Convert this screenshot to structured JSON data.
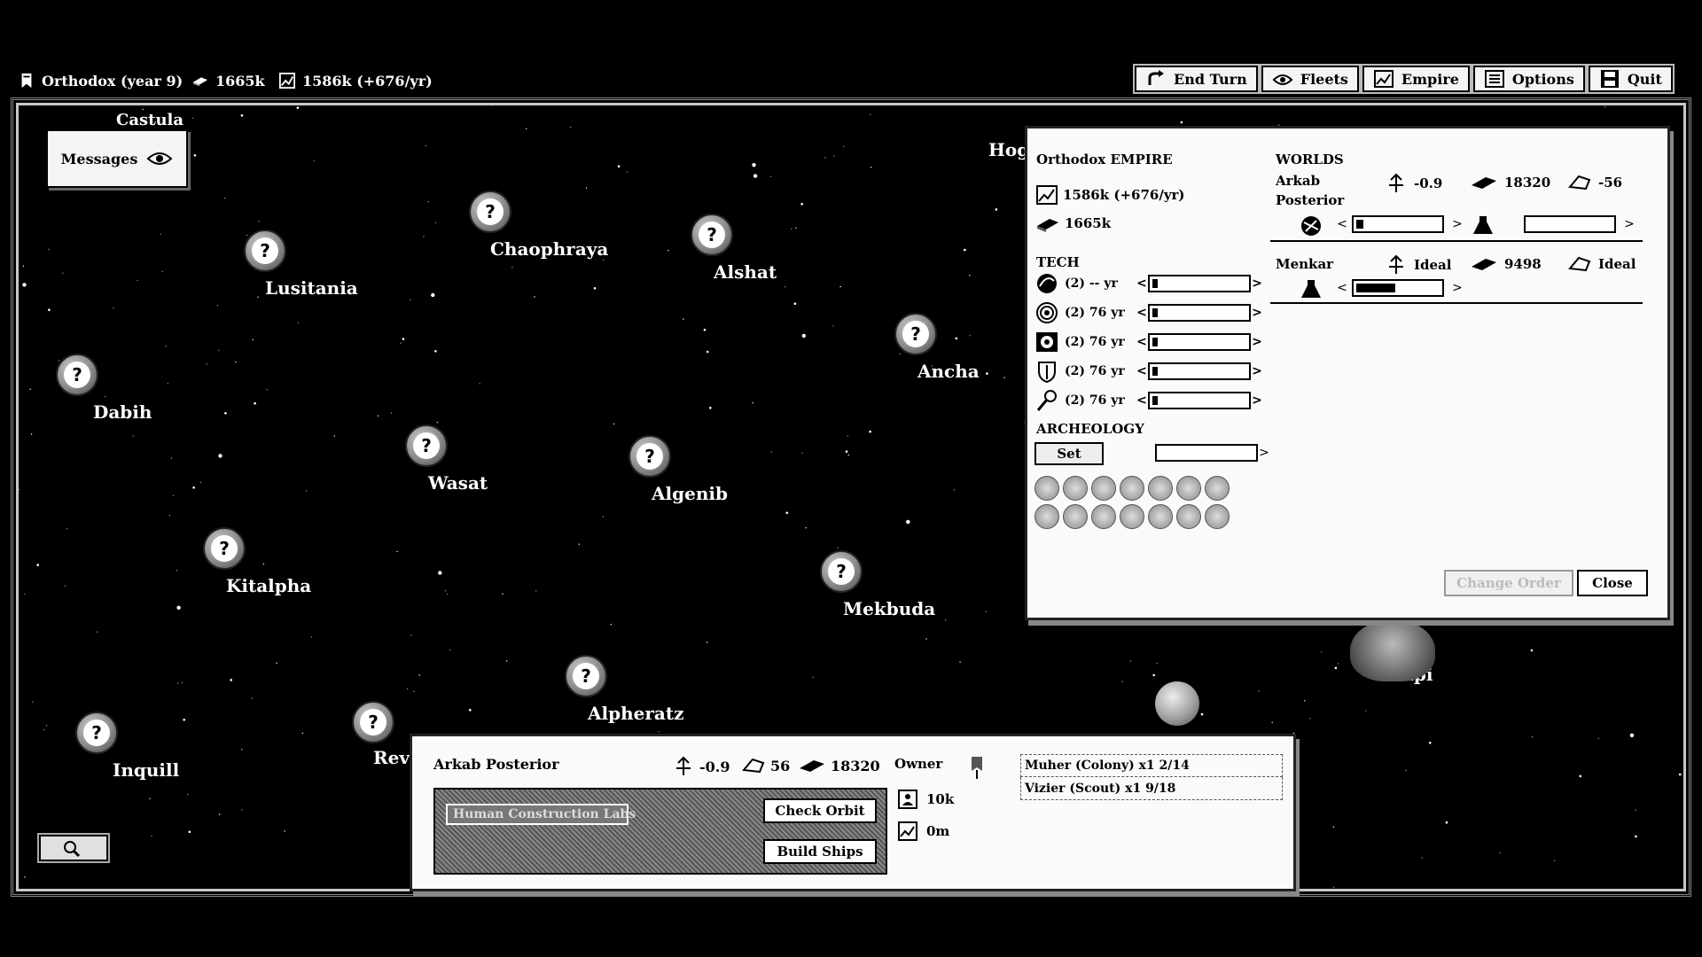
{
  "top": {
    "empire_status": "Orthodox (year 9)",
    "credits": "1665k",
    "production": "1586k (+676/yr)",
    "buttons": [
      {
        "label": "End Turn",
        "icon": "end-turn-icon"
      },
      {
        "label": "Fleets",
        "icon": "fleets-icon"
      },
      {
        "label": "Empire",
        "icon": "empire-icon"
      },
      {
        "label": "Options",
        "icon": "options-icon"
      },
      {
        "label": "Quit",
        "icon": "quit-icon"
      }
    ]
  },
  "map": {
    "messages_label": "Messages",
    "offscreen_labels": [
      "Castula",
      "Hog",
      "Tapi",
      "Reve"
    ],
    "systems": [
      {
        "name": "Chaophraya"
      },
      {
        "name": "Lusitania"
      },
      {
        "name": "Alshat"
      },
      {
        "name": "Ancha"
      },
      {
        "name": "Dabih"
      },
      {
        "name": "Wasat"
      },
      {
        "name": "Algenib"
      },
      {
        "name": "Kitalpha"
      },
      {
        "name": "Mekbuda"
      },
      {
        "name": "Alpheratz"
      },
      {
        "name": "Inquill"
      }
    ]
  },
  "empire_panel": {
    "title": "Orthodox EMPIRE",
    "production": "1586k (+676/yr)",
    "credits": "1665k",
    "tech_header": "TECH",
    "tech_rows": [
      {
        "text": "(2) -- yr",
        "progress": 0.05,
        "icon": "propulsion-icon"
      },
      {
        "text": "(2) 76 yr",
        "progress": 0.05,
        "icon": "shields-icon"
      },
      {
        "text": "(2) 76 yr",
        "progress": 0.05,
        "icon": "weapons-icon"
      },
      {
        "text": "(2) 76 yr",
        "progress": 0.05,
        "icon": "armor-icon"
      },
      {
        "text": "(2) 76 yr",
        "progress": 0.05,
        "icon": "tools-icon"
      }
    ],
    "arch_header": "ARCHEOLOGY",
    "set_label": "Set",
    "worlds_header": "WORLDS",
    "worlds": [
      {
        "name_line1": "Arkab",
        "name_line2": "Posterior",
        "growth": "-0.9",
        "production": "18320",
        "fleet": "-56"
      },
      {
        "name_line1": "Menkar",
        "name_line2": "",
        "growth": "Ideal",
        "production": "9498",
        "fleet": "Ideal"
      }
    ],
    "change_label": "Change Order",
    "close_label": "Close"
  },
  "planet_panel": {
    "name": "Arkab Posterior",
    "growth": "-0.9",
    "fleet": "56",
    "production": "18320",
    "construction_placeholder": "Human Construction Labs",
    "check_orbit_label": "Check Orbit",
    "build_ships_label": "Build Ships",
    "owner_label": "Owner",
    "population": "10k",
    "income": "0m",
    "fleets": [
      "Muher (Colony) x1 2/14",
      "Vizier (Scout) x1 9/18"
    ]
  }
}
